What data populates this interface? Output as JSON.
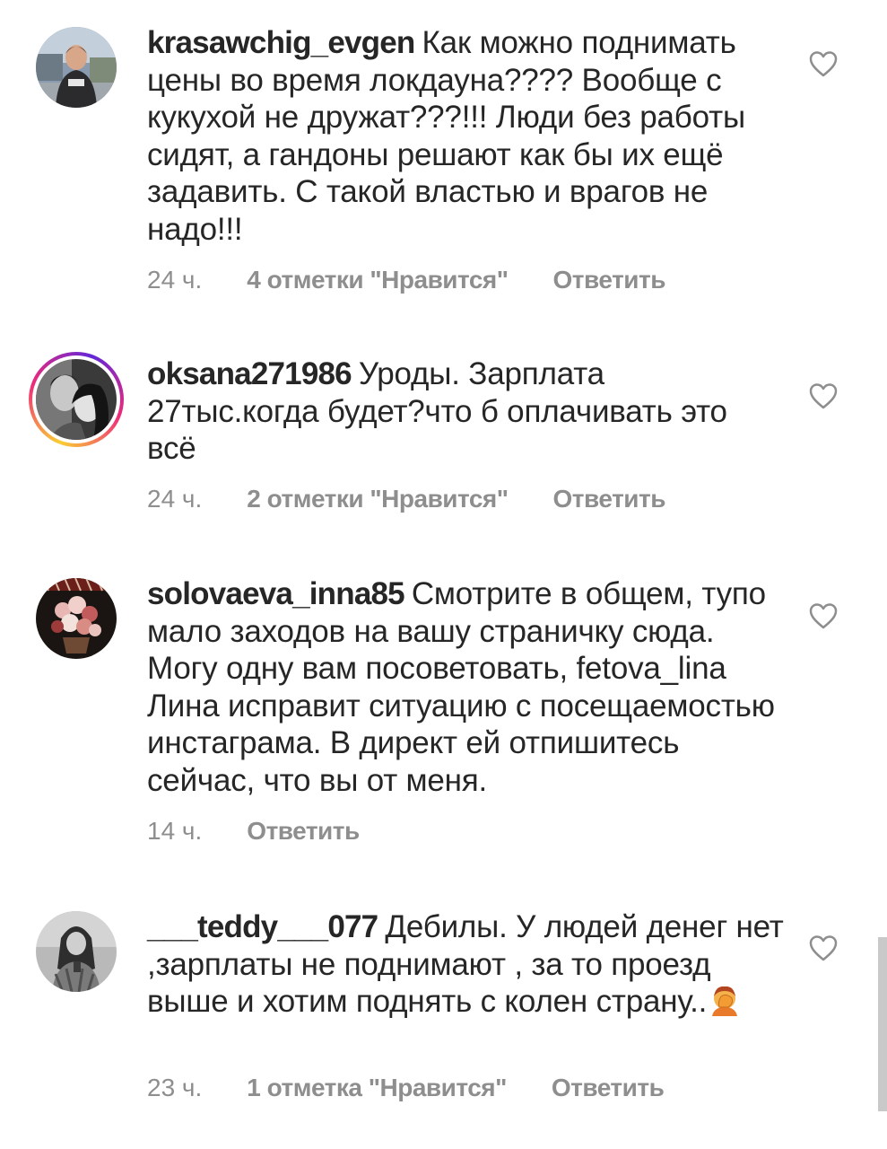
{
  "comments": [
    {
      "username": "krasawchig_evgen",
      "text": "Как можно поднимать цены во время локдауна???? Вообще  с кукухой не дружат???!!! Люди без работы сидят, а гандоны решают как бы их ещё задавить. С такой властью и врагов не надо!!!",
      "time": "24 ч.",
      "likes": "4 отметки \"Нравится\"",
      "reply": "Ответить",
      "like_icon": "heart-outline-icon"
    },
    {
      "username": "oksana271986",
      "text": "Уроды. Зарплата 27тыс.когда будет?что б оплачивать это всё",
      "time": "24 ч.",
      "likes": "2 отметки \"Нравится\"",
      "reply": "Ответить",
      "like_icon": "heart-outline-icon"
    },
    {
      "username": "solovaeva_inna85",
      "text": "Смотрите в общем, тупо мало заходов на вашу страничку сюда. Могу одну вам посоветовать, fetova_lina Лина исправит ситуацию с посещаемостью инстаграма. В директ ей отпишитесь сейчас, что вы от меня.",
      "time": "14 ч.",
      "reply": "Ответить",
      "like_icon": "heart-outline-icon"
    },
    {
      "username": "___teddy___077",
      "text": "Дебилы. У людей денег нет ,зарплаты не поднимают , за то проезд выше и хотим поднять с колен страну..",
      "emoji": "facepalm-emoji",
      "time": "23 ч.",
      "likes": "1 отметка \"Нравится\"",
      "reply": "Ответить",
      "like_icon": "heart-outline-icon"
    }
  ],
  "colors": {
    "text": "#262626",
    "meta": "#8e8e8e",
    "story_ring": [
      "#f9ce34",
      "#ee2a7b",
      "#6228d7"
    ]
  }
}
